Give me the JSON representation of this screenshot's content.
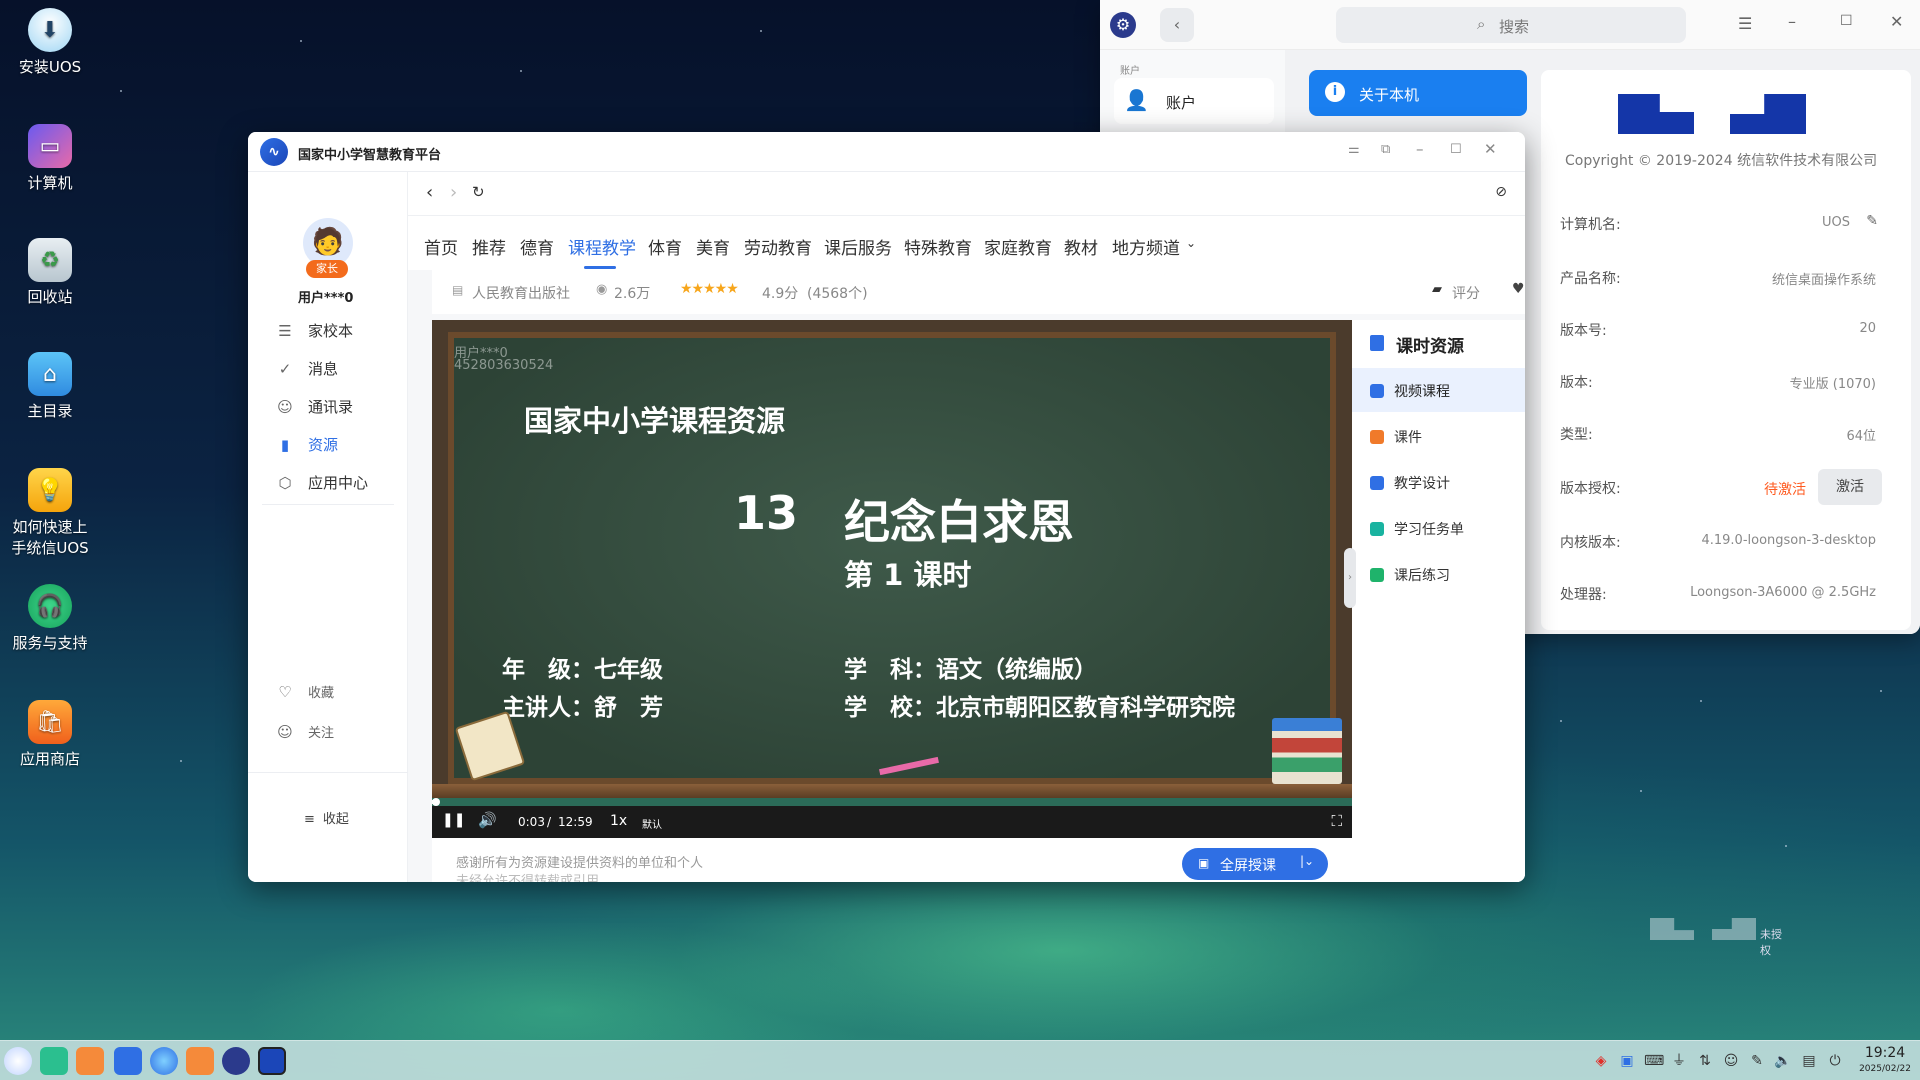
{
  "desktop": {
    "icons": [
      {
        "label": "安装UOS",
        "icon": "install-icon"
      },
      {
        "label": "计算机",
        "icon": "computer-icon"
      },
      {
        "label": "回收站",
        "icon": "trash-icon"
      },
      {
        "label": "主目录",
        "icon": "home-folder-icon"
      },
      {
        "label": "如何快速上手统信UOS",
        "icon": "guide-icon"
      },
      {
        "label": "服务与支持",
        "icon": "support-icon"
      },
      {
        "label": "应用商店",
        "icon": "app-store-icon"
      }
    ],
    "watermark_text": "未授权"
  },
  "settings": {
    "search_placeholder": "搜索",
    "side_section": "账户",
    "side_item": "账户",
    "about_button": "关于本机",
    "copyright": "Copyright © 2019-2024 统信软件技术有限公司",
    "rows": [
      {
        "key": "计算机名:",
        "value": "UOS"
      },
      {
        "key": "产品名称:",
        "value": "统信桌面操作系统"
      },
      {
        "key": "版本号:",
        "value": "20"
      },
      {
        "key": "版本:",
        "value": "专业版 (1070)"
      },
      {
        "key": "类型:",
        "value": "64位"
      },
      {
        "key": "版本授权:",
        "value": "待激活"
      },
      {
        "key": "内核版本:",
        "value": "4.19.0-loongson-3-desktop"
      },
      {
        "key": "处理器:",
        "value": "Loongson-3A6000 @ 2.5GHz"
      }
    ],
    "activate_button": "激活",
    "colors": {
      "accent": "#1a7ff0",
      "warning": "#ff5a1f"
    }
  },
  "edu": {
    "title": "国家中小学智慧教育平台",
    "user": {
      "badge": "家长",
      "name": "用户***0"
    },
    "nav": [
      {
        "label": "家校本",
        "icon": "notebook-icon"
      },
      {
        "label": "消息",
        "icon": "message-icon"
      },
      {
        "label": "通讯录",
        "icon": "contacts-icon"
      },
      {
        "label": "资源",
        "icon": "book-icon"
      },
      {
        "label": "应用中心",
        "icon": "app-center-icon"
      }
    ],
    "nav2": [
      {
        "label": "收藏",
        "icon": "heart-icon"
      },
      {
        "label": "关注",
        "icon": "follow-icon"
      }
    ],
    "collapse": "收起",
    "tabs": [
      "首页",
      "推荐",
      "德育",
      "课程教学",
      "体育",
      "美育",
      "劳动教育",
      "课后服务",
      "特殊教育",
      "家庭教育",
      "教材",
      "地方频道"
    ],
    "active_tab": "课程教学",
    "meta": {
      "publisher": "人民教育出版社",
      "views": "2.6万",
      "rating": "4.9分",
      "rating_count": "(4568个)",
      "rate_label": "评分"
    },
    "video": {
      "watermark_user": "用户***0",
      "watermark_id": "452803630524",
      "heading": "国家中小学课程资源",
      "lesson_no": "13",
      "lesson_title": "纪念白求恩",
      "period": "第 1 课时",
      "grade_label": "年　级：七年级",
      "subject_label": "学　科：语文（统编版）",
      "teacher_label": "主讲人：舒　芳",
      "school_label": "学　校：北京市朝阳区教育科学研究院",
      "time_current": "0:03",
      "time_total": "12:59",
      "speed": "1x",
      "quality": "默认",
      "progress": 0.004
    },
    "resources": {
      "title": "课时资源",
      "items": [
        {
          "label": "视频课程",
          "color": "#2f6fe4"
        },
        {
          "label": "课件",
          "color": "#f07a2a"
        },
        {
          "label": "教学设计",
          "color": "#2f6fe4"
        },
        {
          "label": "学习任务单",
          "color": "#19b3a0"
        },
        {
          "label": "课后练习",
          "color": "#1fb36b"
        }
      ]
    },
    "footer_note": "感谢所有为资源建设提供资料的单位和个人",
    "footer_note2": "未经允许不得转载或引用",
    "fullscreen_button": "全屏授课"
  },
  "taskbar": {
    "clock_time": "19:24",
    "clock_date": "2025/02/22"
  }
}
